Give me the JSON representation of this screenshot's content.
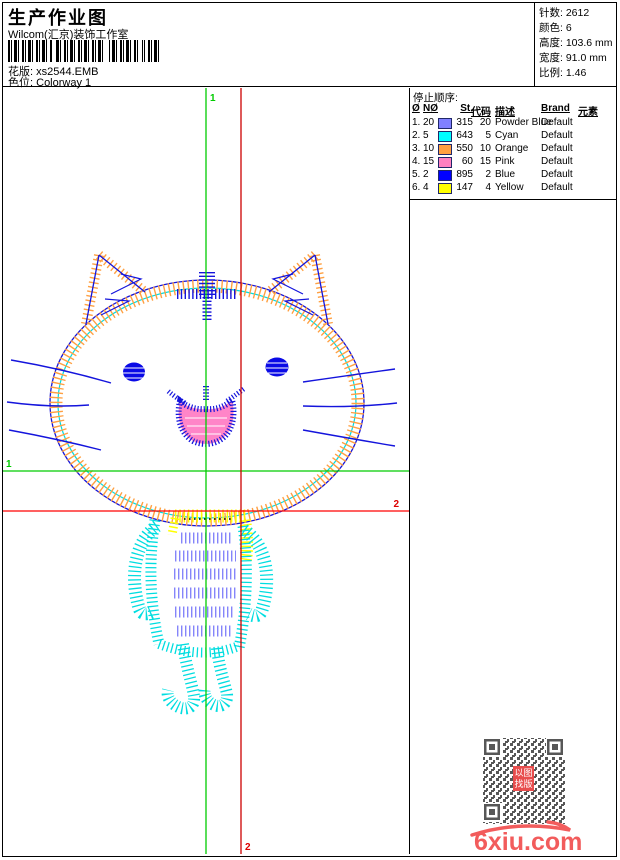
{
  "header": {
    "title": "生产作业图",
    "studio": "Wilcom(汇京)装饰工作室",
    "pattern_label": "花版:",
    "pattern_value": "xs2544.EMB",
    "colorway_label": "色位:",
    "colorway_value": "Colorway 1"
  },
  "info": {
    "rows": [
      {
        "label": "针数:",
        "value": "2612"
      },
      {
        "label": "颜色:",
        "value": "6"
      },
      {
        "label": "高度:",
        "value": "103.6 mm"
      },
      {
        "label": "宽度:",
        "value": "91.0 mm"
      },
      {
        "label": "比例:",
        "value": "1.46"
      }
    ]
  },
  "stop_sequence": {
    "title": "停止顺序:",
    "headers": {
      "num": "Ø",
      "needle": "NØ",
      "st": "St.",
      "code": "代码",
      "desc": "描述",
      "brand": "Brand",
      "element": "元素"
    },
    "rows": [
      {
        "no": "1.",
        "needle": "20",
        "swatch": "#8080FF",
        "st": "315",
        "code": "20",
        "desc": "Powder Blue",
        "brand": "Default"
      },
      {
        "no": "2.",
        "needle": "5",
        "swatch": "#00FFFF",
        "st": "643",
        "code": "5",
        "desc": "Cyan",
        "brand": "Default"
      },
      {
        "no": "3.",
        "needle": "10",
        "swatch": "#FFA040",
        "st": "550",
        "code": "10",
        "desc": "Orange",
        "brand": "Default"
      },
      {
        "no": "4.",
        "needle": "15",
        "swatch": "#FF80C0",
        "st": "60",
        "code": "15",
        "desc": "Pink",
        "brand": "Default"
      },
      {
        "no": "5.",
        "needle": "2",
        "swatch": "#0000FF",
        "st": "895",
        "code": "2",
        "desc": "Blue",
        "brand": "Default"
      },
      {
        "no": "6.",
        "needle": "4",
        "swatch": "#FFFF00",
        "st": "147",
        "code": "4",
        "desc": "Yellow",
        "brand": "Default"
      }
    ]
  },
  "canvas_markers": {
    "start": "1",
    "end": "2",
    "start_color": "#00CC00",
    "end_color": "#DD0000"
  },
  "design_colors": {
    "powder_blue": "#8585FA",
    "cyan": "#00E0E0",
    "orange": "#FFA042",
    "pink": "#FF85C8",
    "blue": "#1414DC",
    "yellow": "#FFFF00"
  },
  "seal": {
    "line1": "以图",
    "line2": "找版"
  },
  "watermark": {
    "site": "6xiu.com"
  }
}
